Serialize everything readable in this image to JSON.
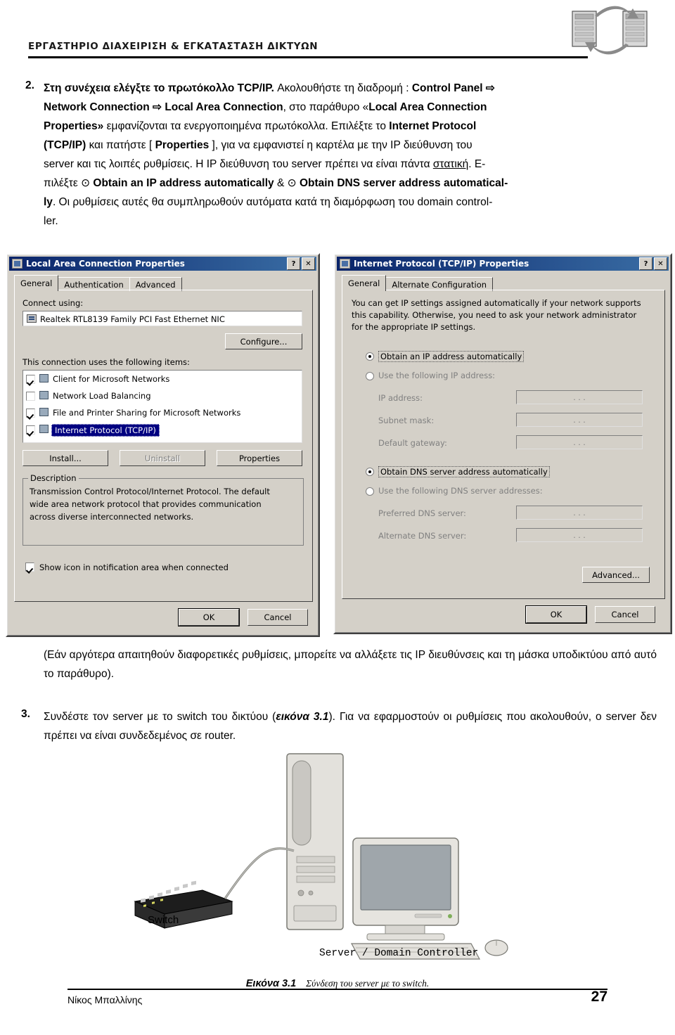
{
  "header": {
    "lab_title": "ΕΡΓΑΣΤΗΡΙΟ ΔΙΑΧΕΙΡΙΣΗ & ΕΓΚΑΤΑΣΤΑΣΗ ΔΙΚΤΥΩΝ"
  },
  "step2": {
    "number": "2.",
    "l1_a": "Στη συνέχεια ελέγξτε το πρωτόκολλο TCP/IP.",
    "l1_b": " Ακολουθήστε τη διαδρομή : ",
    "l1_c": "Control Panel",
    "l1_arrow": "⇨",
    "l2_a": "Network Connection",
    "l2_arrow": "⇨",
    "l2_b": "Local Area Connection",
    "l2_c": ", στο παράθυρο «",
    "l2_d": "Local Area Connection",
    "l3_a": "Properties»",
    "l3_b": " εμφανίζονται τα ενεργοποιημένα πρωτόκολλα. Επιλέξτε το ",
    "l3_c": "Internet Protocol",
    "l4_a": "(TCP/IP)",
    "l4_b": " και πατήστε [ ",
    "l4_c": "Properties",
    "l4_d": " ], για να εμφανιστεί η καρτέλα με την IP διεύθυνση του",
    "l5_a": "server και τις λοιπές ρυθμίσεις.",
    "l5_b": " Η IP διεύθυνση του server πρέπει να είναι πάντα ",
    "l5_c": "στατική",
    "l5_d": ". Ε-",
    "l6_a": "πιλέξτε ",
    "l6_radio1": "⊙",
    "l6_b": "Obtain an IP address automatically",
    "l6_c": " & ",
    "l6_radio2": "⊙",
    "l6_d": "Obtain DNS server address automatical-",
    "l7_a": "ly",
    "l7_b": ". Οι ρυθμίσεις αυτές θα συμπληρωθούν αυτόματα κατά τη διαμόρφωση του domain control-",
    "l8_a": "ler."
  },
  "dialog_lac": {
    "title": "Local Area Connection Properties",
    "help_btn": "?",
    "close_btn": "✕",
    "tabs": [
      "General",
      "Authentication",
      "Advanced"
    ],
    "selected_tab": "General",
    "connect_using_label": "Connect using:",
    "adapter": "Realtek RTL8139 Family PCI Fast Ethernet NIC",
    "configure_btn": "Configure...",
    "items_label": "This connection uses the following items:",
    "items": [
      {
        "label": "Client for Microsoft Networks",
        "checked": true,
        "selected": false
      },
      {
        "label": "Network Load Balancing",
        "checked": false,
        "selected": false
      },
      {
        "label": "File and Printer Sharing for Microsoft Networks",
        "checked": true,
        "selected": false
      },
      {
        "label": "Internet Protocol (TCP/IP)",
        "checked": true,
        "selected": true
      }
    ],
    "install_btn": "Install...",
    "uninstall_btn": "Uninstall",
    "properties_btn": "Properties",
    "description_label": "Description",
    "description_l1": "Transmission Control Protocol/Internet Protocol. The default",
    "description_l2": "wide area network protocol that provides communication",
    "description_l3": "across diverse interconnected networks.",
    "show_icon_label": "Show icon in notification area when connected",
    "show_icon_checked": true,
    "ok_btn": "OK",
    "cancel_btn": "Cancel"
  },
  "dialog_tcpip": {
    "title": "Internet Protocol (TCP/IP) Properties",
    "help_btn": "?",
    "close_btn": "✕",
    "tabs": [
      "General",
      "Alternate Configuration"
    ],
    "selected_tab": "General",
    "intro_l1": "You can get IP settings assigned automatically if your network supports",
    "intro_l2": "this capability. Otherwise, you need to ask your network administrator",
    "intro_l3": "for the appropriate IP settings.",
    "radio_auto_ip": "Obtain an IP address automatically",
    "radio_manual_ip": "Use the following IP address:",
    "ip_fields": [
      {
        "label": "IP address:",
        "value": ".   .   ."
      },
      {
        "label": "Subnet mask:",
        "value": ".   .   ."
      },
      {
        "label": "Default gateway:",
        "value": ".   .   ."
      }
    ],
    "radio_auto_dns": "Obtain DNS server address automatically",
    "radio_manual_dns": "Use the following DNS server addresses:",
    "dns_fields": [
      {
        "label": "Preferred DNS server:",
        "value": ".   .   ."
      },
      {
        "label": "Alternate DNS server:",
        "value": ".   .   ."
      }
    ],
    "advanced_btn": "Advanced...",
    "ok_btn": "OK",
    "cancel_btn": "Cancel",
    "selected_radio_ip": "auto",
    "selected_radio_dns": "auto"
  },
  "note": {
    "l1": "(Εάν αργότερα απαιτηθούν διαφορετικές ρυθμίσεις, μπορείτε να αλλάξετε τις IP διευθύνσεις",
    "l2": "και τη μάσκα υποδικτύου από αυτό το παράθυρο)."
  },
  "step3": {
    "number": "3.",
    "l1_a": "Συνδέστε τον server με το switch του δικτύου (",
    "l1_b": "εικόνα 3.1",
    "l1_c": "). Για να εφαρμοστούν οι ρυθμίσεις",
    "l2_a": "που ακολουθούν, ο server δεν πρέπει να είναι συνδεδεμένος σε router."
  },
  "figure": {
    "switch_label": "Switch",
    "server_label": "Server / Domain Controller",
    "caption_bold": "Εικόνα 3.1",
    "caption_italic": "Σύνδεση του server με το switch."
  },
  "footer": {
    "author": "Νίκος Μπαλλίνης",
    "page": "27"
  }
}
